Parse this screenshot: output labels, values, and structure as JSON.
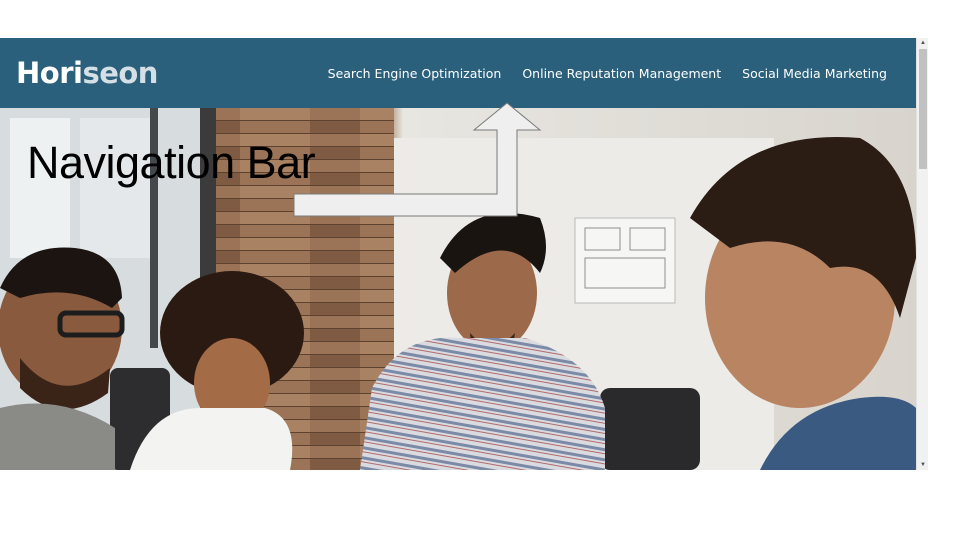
{
  "header": {
    "logo_part1": "Hori",
    "logo_part2": "seon"
  },
  "nav": {
    "items": [
      {
        "label": "Search Engine Optimization"
      },
      {
        "label": "Online Reputation Management"
      },
      {
        "label": "Social Media Marketing"
      }
    ]
  },
  "annotation": {
    "label": "Navigation Bar"
  },
  "colors": {
    "navbar_background": "#2a607c",
    "nav_text": "#ffffff",
    "logo_secondary": "#d4dfe6",
    "annotation_arrow": "#efefef",
    "annotation_arrow_stroke": "#7a7a7a"
  },
  "hero": {
    "icon": "team-meeting-photo"
  }
}
